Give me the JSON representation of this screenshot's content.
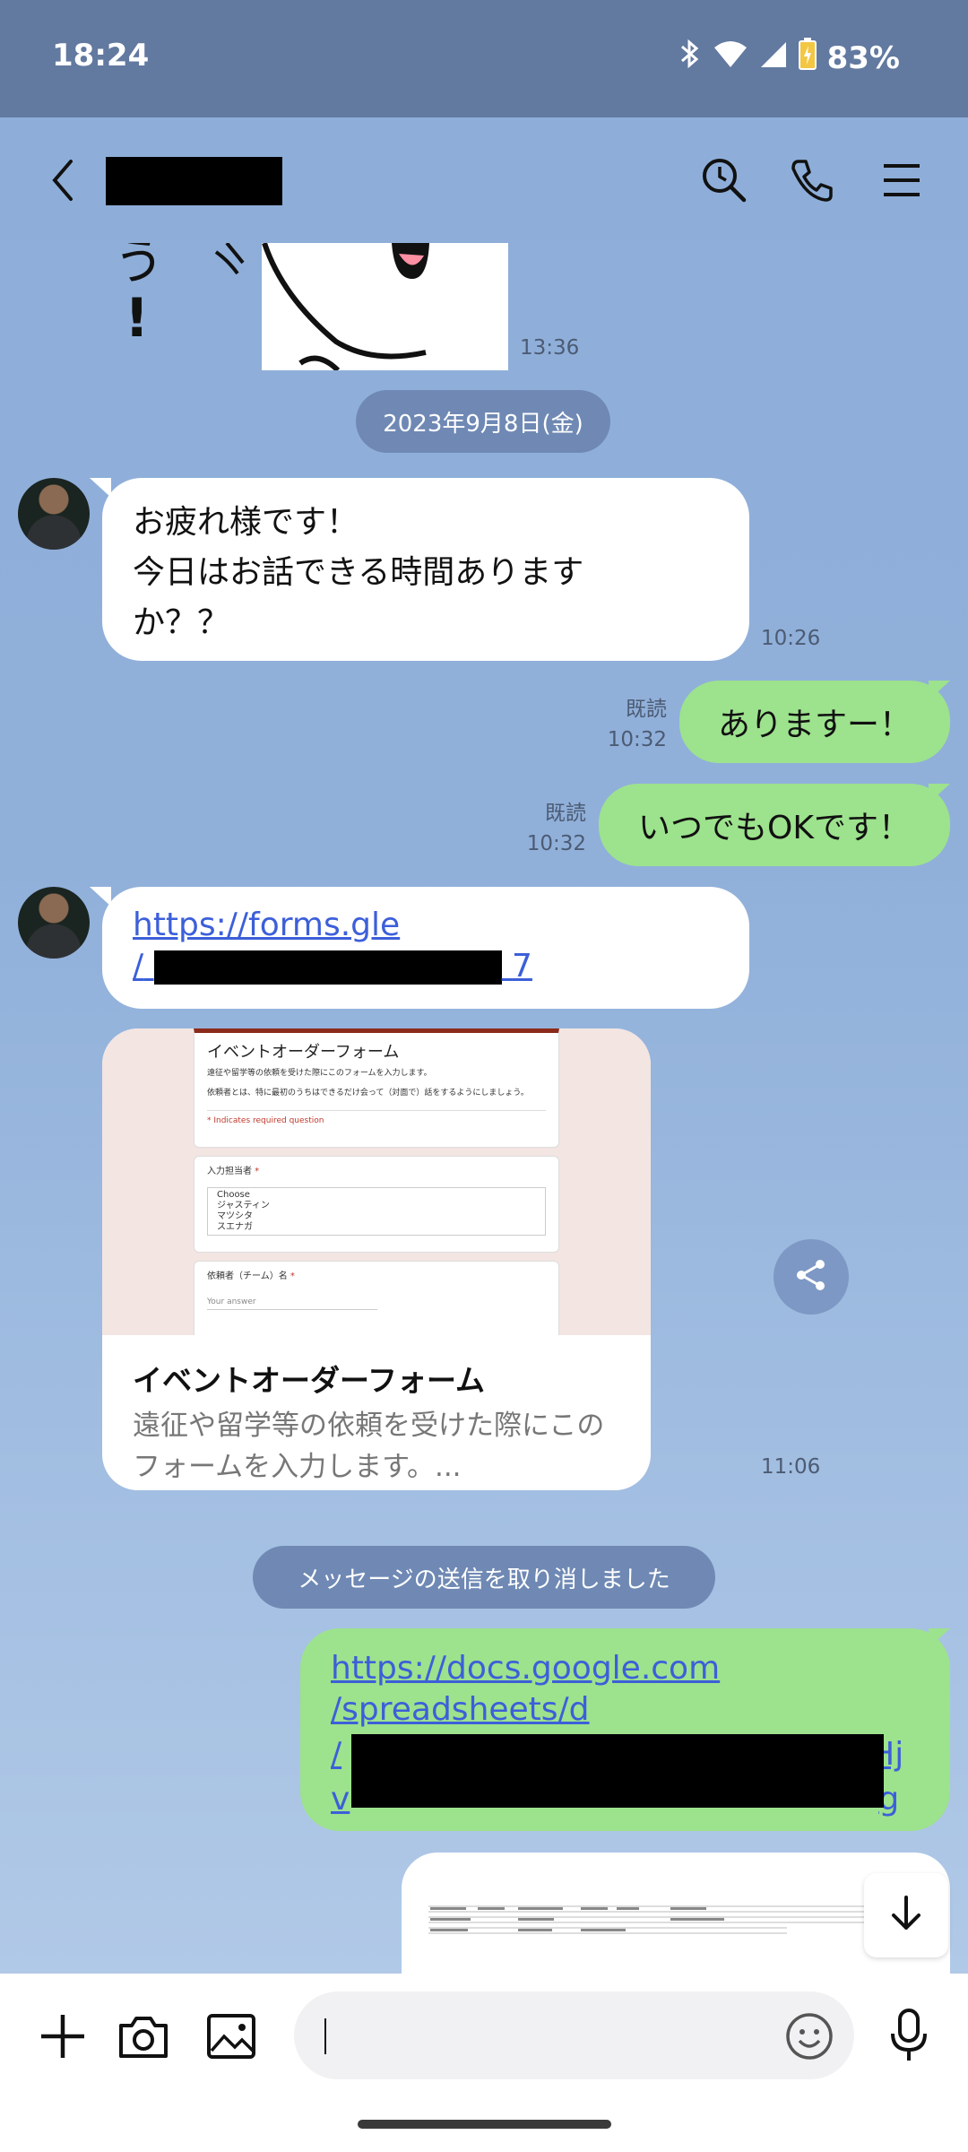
{
  "status": {
    "time": "18:24",
    "battery": "83%"
  },
  "header": {
    "contact_name_redacted": true
  },
  "messages": {
    "sticker_time": "13:36",
    "date_separator": "2023年9月8日(金)",
    "m1": {
      "lines": [
        "お疲れ様です！",
        "今日はお話できる時間あります",
        "か？？"
      ],
      "time": "10:26"
    },
    "m2": {
      "text": "ありますー！",
      "read": "既読",
      "time": "10:32"
    },
    "m3": {
      "text": "いつでもOKです！",
      "read": "既読",
      "time": "10:32"
    },
    "m4": {
      "link_line1": "https://forms.gle",
      "link_line2_prefix": "/",
      "link_line2_suffix": "7"
    },
    "preview": {
      "title": "イベントオーダーフォーム",
      "desc_line1": "遠征や留学等の依頼を受けた際にこの",
      "desc_line2": "フォームを入力します。...",
      "time": "11:06",
      "thumb": {
        "form_title": "イベントオーダーフォーム",
        "form_desc1": "遠征や留学等の依頼を受けた際にこのフォームを入力します。",
        "form_desc2": "依頼者とは、特に最初のうちはできるだけ会って（対面で）話をするようにしましょう。",
        "required_note": "* Indicates required question",
        "q1_label": "入力担当者",
        "q1_options": [
          "Choose",
          "ジャスティン",
          "マツシタ",
          "スエナガ"
        ],
        "q2_label": "依頼者（チーム）名",
        "q2_placeholder": "Your answer"
      }
    },
    "system_notice": "メッセージの送信を取り消しました",
    "m5": {
      "link_line1": "https://docs.google.com",
      "link_line2": "/spreadsheets/d",
      "link_line3_prefix": "/",
      "link_line3_suffix": "Hj",
      "link_line4_prefix": "v",
      "link_line4_suffix": "g"
    }
  },
  "input": {
    "placeholder": ""
  },
  "colors": {
    "header_bar": "#6279a0",
    "chat_bg": "#8eaed9",
    "bubble_out": "#9de28d",
    "bubble_in": "#ffffff",
    "link": "#3c5fd9"
  }
}
